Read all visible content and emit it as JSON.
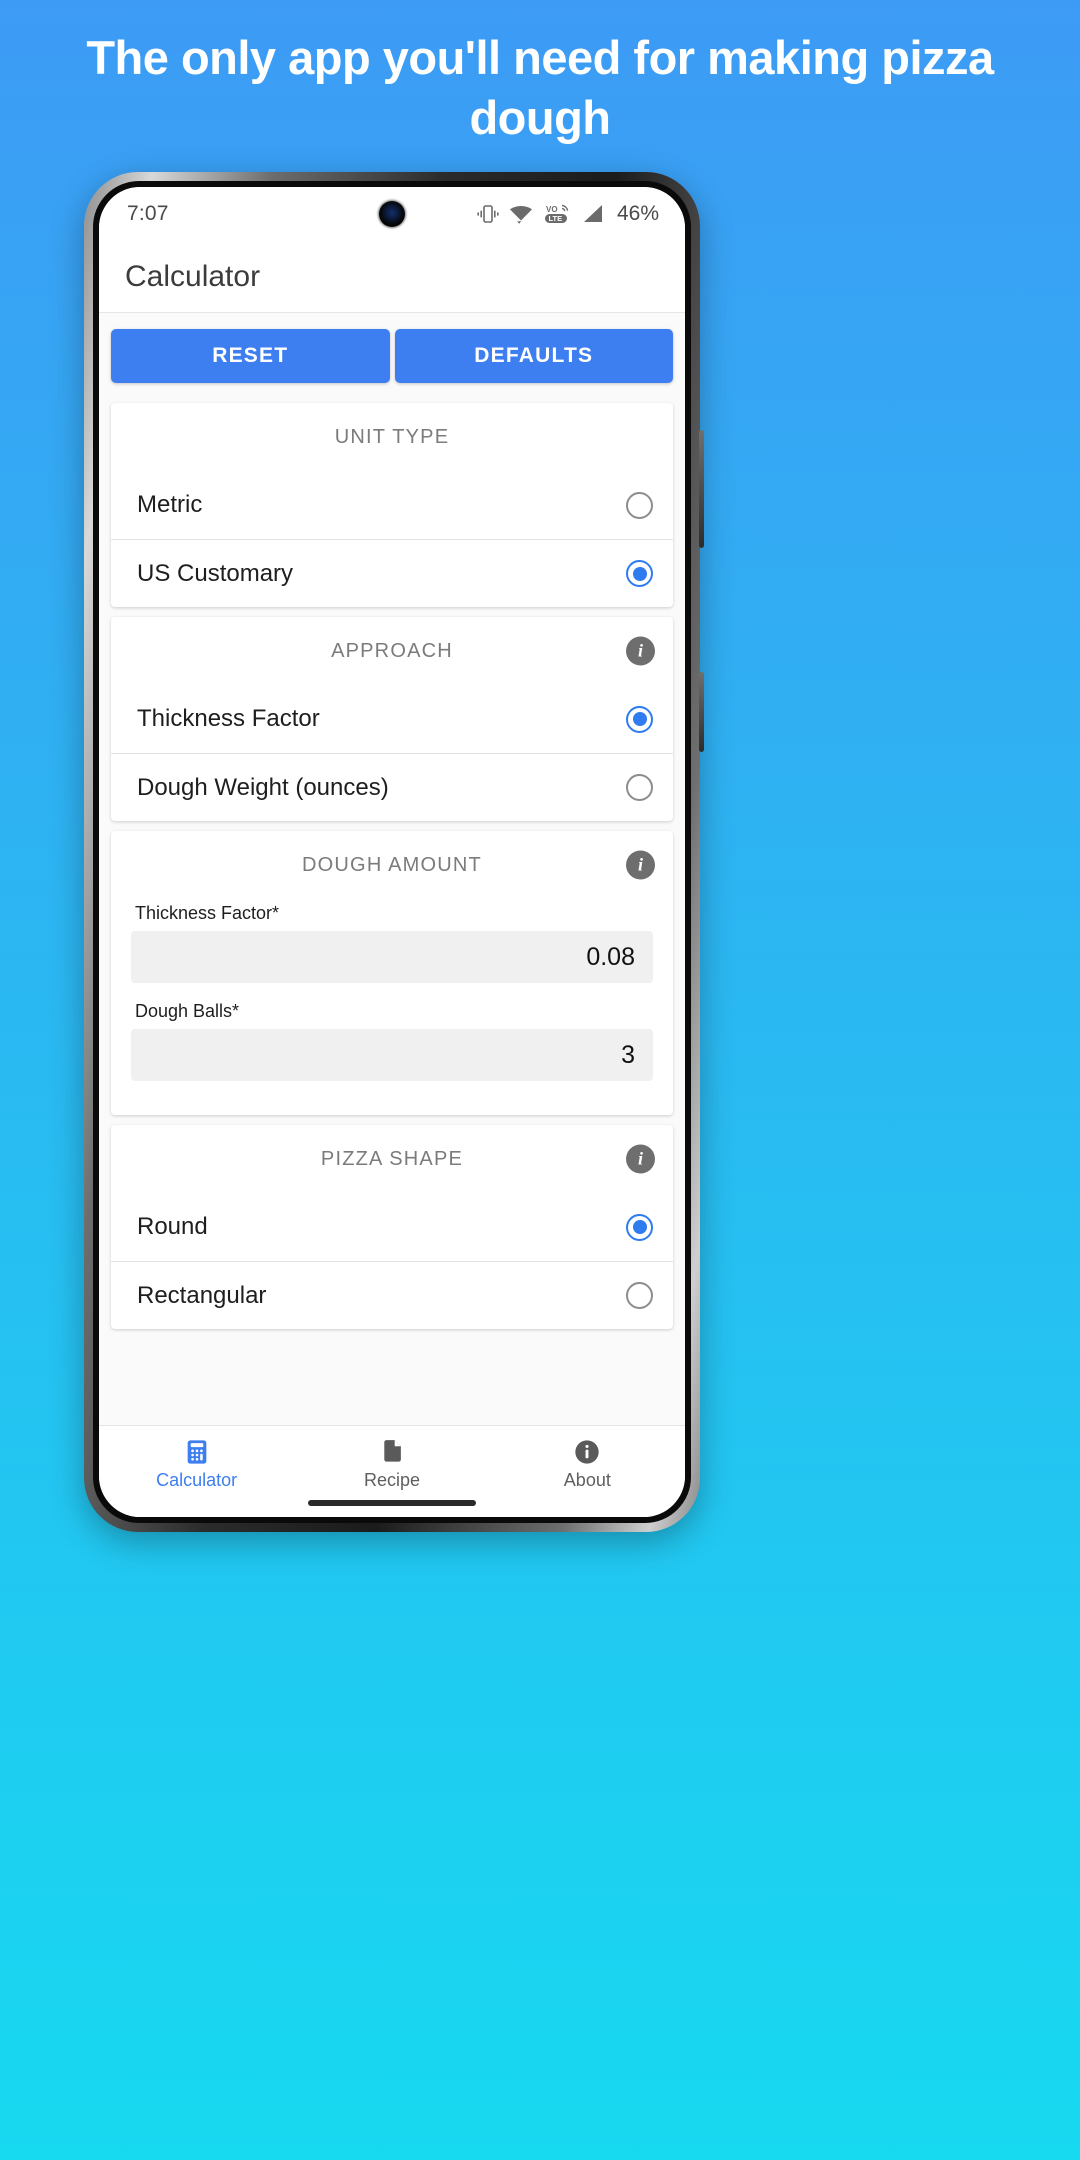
{
  "promo": {
    "headline": "The only app you'll need for making pizza dough",
    "background_top": "#3d9bf5",
    "background_bottom": "#17d9f0"
  },
  "status_bar": {
    "time": "7:07",
    "battery": "46%",
    "icons": [
      "vibrate-icon",
      "wifi-icon",
      "volte-icon",
      "signal-icon"
    ]
  },
  "app_bar": {
    "title": "Calculator"
  },
  "actions": {
    "reset_label": "RESET",
    "defaults_label": "DEFAULTS",
    "accent_color": "#3d7ef0"
  },
  "cards": [
    {
      "title": "UNIT TYPE",
      "has_info": false,
      "options": [
        {
          "label": "Metric",
          "selected": false
        },
        {
          "label": "US Customary",
          "selected": true
        }
      ]
    },
    {
      "title": "APPROACH",
      "has_info": true,
      "options": [
        {
          "label": "Thickness Factor",
          "selected": true
        },
        {
          "label": "Dough Weight (ounces)",
          "selected": false
        }
      ]
    },
    {
      "title": "DOUGH AMOUNT",
      "has_info": true,
      "fields": [
        {
          "label": "Thickness Factor*",
          "value": "0.08"
        },
        {
          "label": "Dough Balls*",
          "value": "3"
        }
      ]
    },
    {
      "title": "PIZZA SHAPE",
      "has_info": true,
      "options": [
        {
          "label": "Round",
          "selected": true
        },
        {
          "label": "Rectangular",
          "selected": false
        }
      ]
    }
  ],
  "bottom_nav": {
    "items": [
      {
        "label": "Calculator",
        "icon": "calculator-icon",
        "active": true
      },
      {
        "label": "Recipe",
        "icon": "document-icon",
        "active": false
      },
      {
        "label": "About",
        "icon": "info-circle-icon",
        "active": false
      }
    ]
  },
  "info_glyph": "i"
}
